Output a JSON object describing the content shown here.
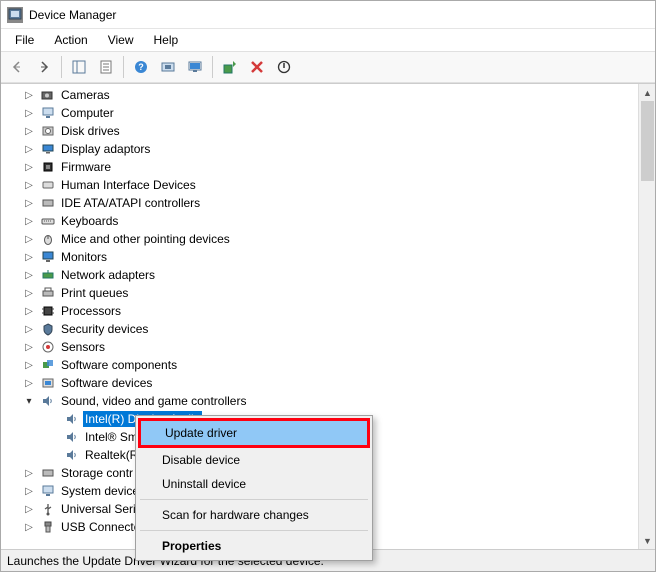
{
  "window": {
    "title": "Device Manager"
  },
  "menubar": {
    "file": "File",
    "action": "Action",
    "view": "View",
    "help": "Help"
  },
  "tree": {
    "cameras": "Cameras",
    "computer": "Computer",
    "disk_drives": "Disk drives",
    "display_adaptors": "Display adaptors",
    "firmware": "Firmware",
    "hid": "Human Interface Devices",
    "ide": "IDE ATA/ATAPI controllers",
    "keyboards": "Keyboards",
    "mice": "Mice and other pointing devices",
    "monitors": "Monitors",
    "network": "Network adapters",
    "print_queues": "Print queues",
    "processors": "Processors",
    "security": "Security devices",
    "sensors": "Sensors",
    "software_components": "Software components",
    "software_devices": "Software devices",
    "sound": "Sound, video and game controllers",
    "sound_child1": "Intel(R) Display Audio",
    "sound_child2": "Intel® Sm",
    "sound_child3": "Realtek(R)",
    "storage": "Storage contr",
    "system": "System device",
    "usb_serial": "Universal Seri",
    "usb_connector": "USB Connecto"
  },
  "context_menu": {
    "update": "Update driver",
    "disable": "Disable device",
    "uninstall": "Uninstall device",
    "scan": "Scan for hardware changes",
    "properties": "Properties"
  },
  "statusbar": {
    "text": "Launches the Update Driver Wizard for the selected device."
  }
}
